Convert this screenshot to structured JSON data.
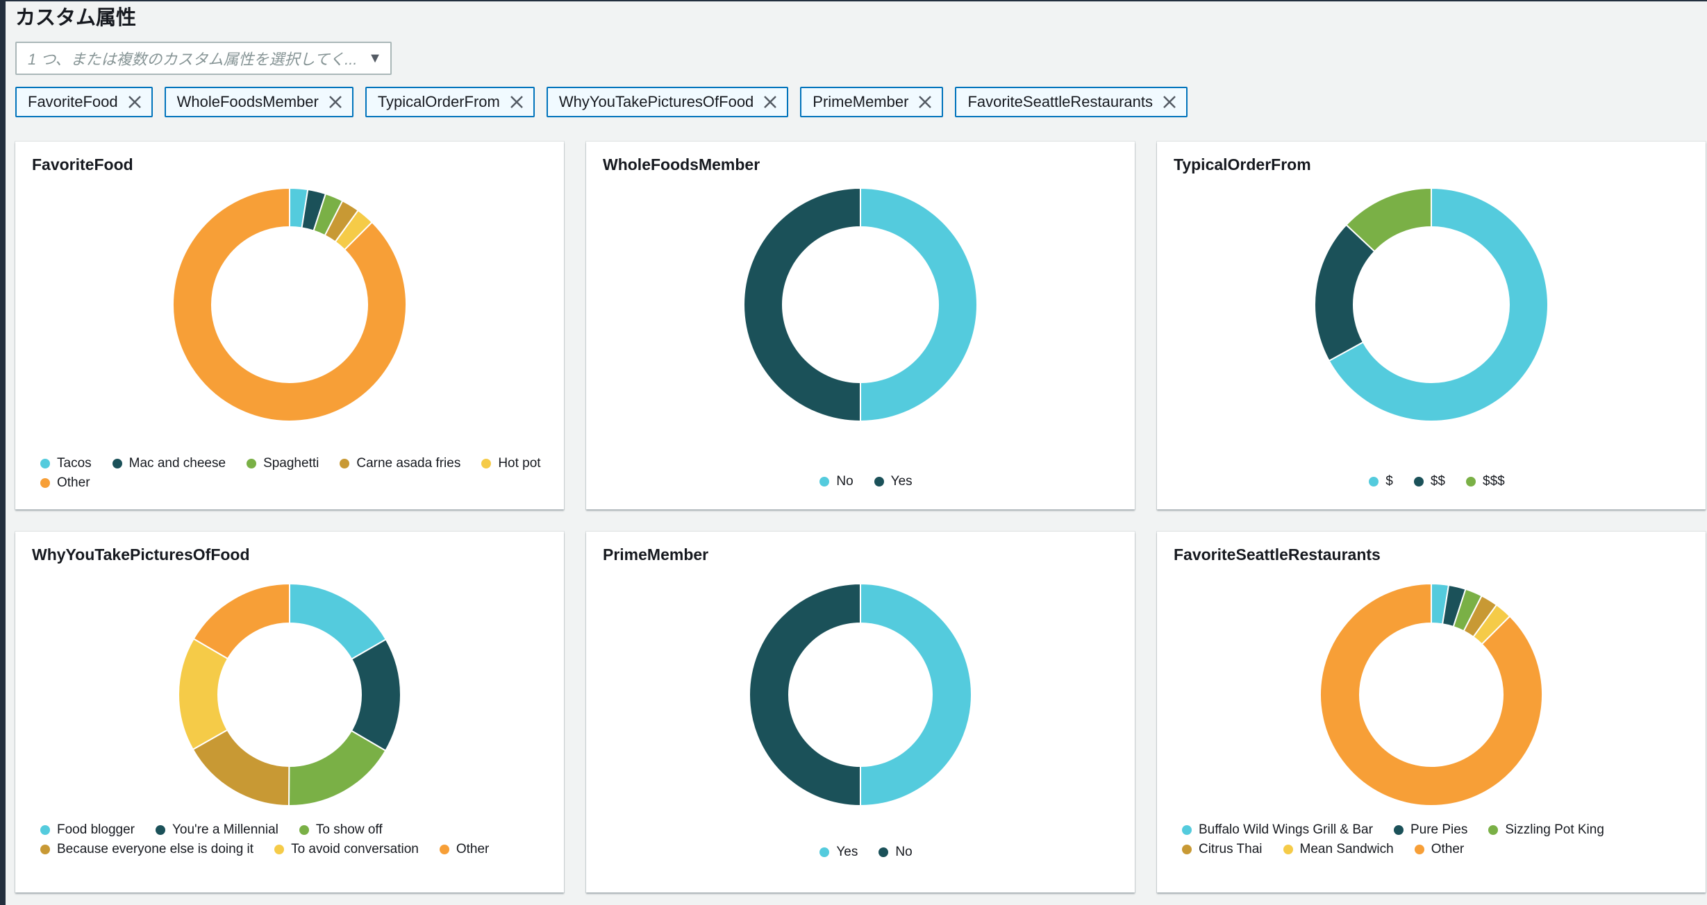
{
  "section": {
    "title": "カスタム属性",
    "select_placeholder": "1 つ、または複数のカスタム属性を選択してく...",
    "tokens": [
      "FavoriteFood",
      "WholeFoodsMember",
      "TypicalOrderFrom",
      "WhyYouTakePicturesOfFood",
      "PrimeMember",
      "FavoriteSeattleRestaurants"
    ]
  },
  "colors": {
    "cyan": "#54cbdd",
    "teal": "#1b5159",
    "green": "#7ab046",
    "gold": "#c89934",
    "yellow": "#f5cb48",
    "orange": "#f79f37"
  },
  "chart_data": [
    {
      "type": "pie",
      "title": "FavoriteFood",
      "categories": [
        "Tacos",
        "Mac and cheese",
        "Spaghetti",
        "Carne asada fries",
        "Hot pot",
        "Other"
      ],
      "values": [
        2.5,
        2.5,
        2.5,
        2.5,
        2.5,
        87.5
      ]
    },
    {
      "type": "pie",
      "title": "WholeFoodsMember",
      "categories": [
        "No",
        "Yes"
      ],
      "values": [
        50,
        50
      ]
    },
    {
      "type": "pie",
      "title": "TypicalOrderFrom",
      "categories": [
        "$",
        "$$",
        "$$$"
      ],
      "values": [
        67,
        20,
        13
      ]
    },
    {
      "type": "pie",
      "title": "WhyYouTakePicturesOfFood",
      "categories": [
        "Food blogger",
        "You're a Millennial",
        "To show off",
        "Because everyone else is doing it",
        "To avoid conversation",
        "Other"
      ],
      "values": [
        16.7,
        16.7,
        16.7,
        16.7,
        16.6,
        16.6
      ]
    },
    {
      "type": "pie",
      "title": "PrimeMember",
      "categories": [
        "Yes",
        "No"
      ],
      "values": [
        50,
        50
      ]
    },
    {
      "type": "pie",
      "title": "FavoriteSeattleRestaurants",
      "categories": [
        "Buffalo Wild Wings Grill & Bar",
        "Pure Pies",
        "Sizzling Pot King",
        "Citrus Thai",
        "Mean Sandwich",
        "Other"
      ],
      "values": [
        2.5,
        2.5,
        2.5,
        2.5,
        2.5,
        87.5
      ]
    }
  ]
}
